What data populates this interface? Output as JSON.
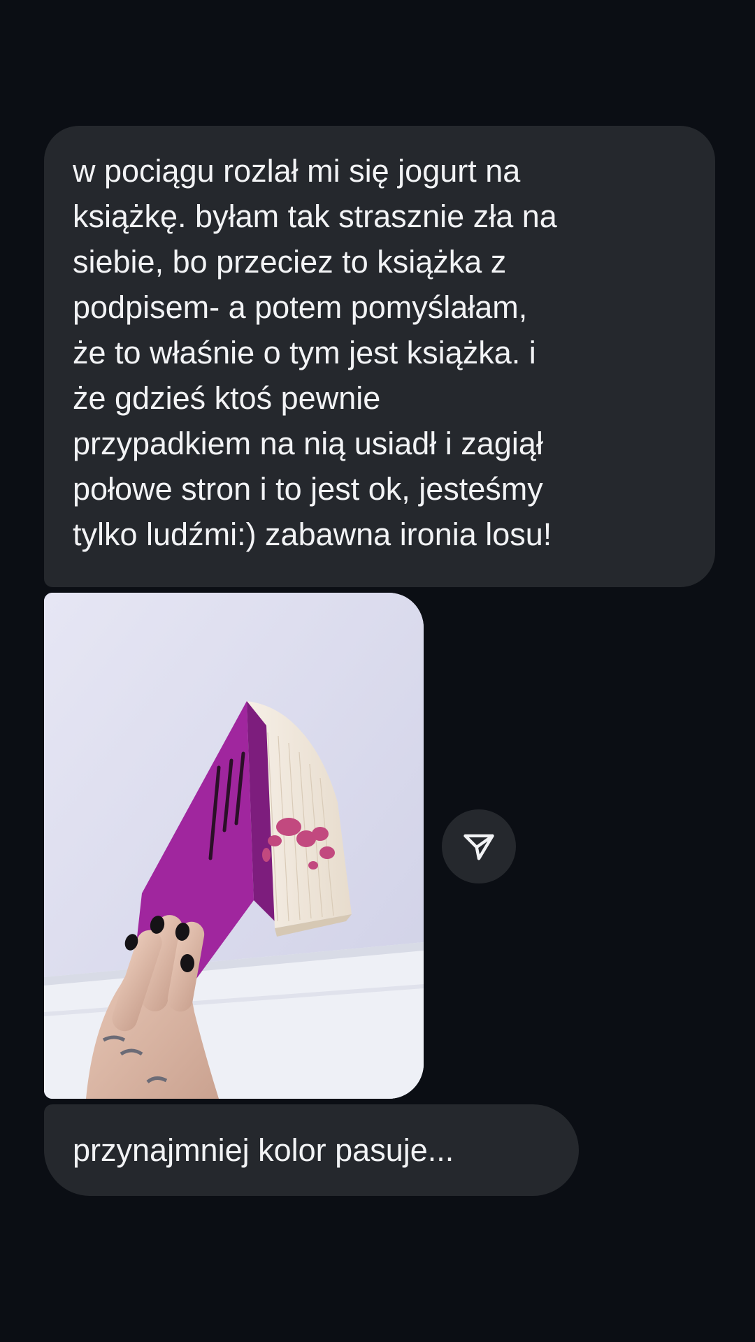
{
  "messages": [
    {
      "type": "text",
      "lines": [
        "w pociągu rozlał mi się jogurt na",
        "książkę. byłam tak strasznie zła na",
        "siebie, bo przeciez to książka z",
        "podpisem- a potem pomyślałam,",
        "że to właśnie o tym jest książka. i",
        "że gdzieś ktoś pewnie",
        "przypadkiem na nią usiadł i zagiął",
        "połowe stron i to jest ok, jesteśmy",
        "tylko ludźmi:) zabawna ironia losu!"
      ]
    },
    {
      "type": "photo",
      "content": "hand holding a magenta book with pink yogurt stains on the page edges"
    },
    {
      "type": "text",
      "text": "przynajmniej kolor pasuje..."
    }
  ],
  "share_button": {
    "icon": "send-icon"
  },
  "colors": {
    "background": "#0b0e14",
    "bubble": "#25282d",
    "text": "#f2f3f5",
    "book_cover": "#a0269e",
    "stain": "#c2497f"
  }
}
